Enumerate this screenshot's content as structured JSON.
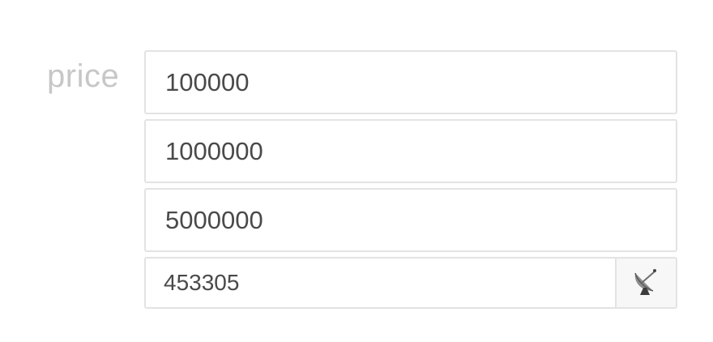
{
  "form": {
    "label": "price",
    "fields": [
      {
        "value": "100000"
      },
      {
        "value": "1000000"
      },
      {
        "value": "5000000"
      }
    ],
    "live_field": {
      "value": "453305",
      "addon_icon": "satellite-dish-icon"
    }
  }
}
